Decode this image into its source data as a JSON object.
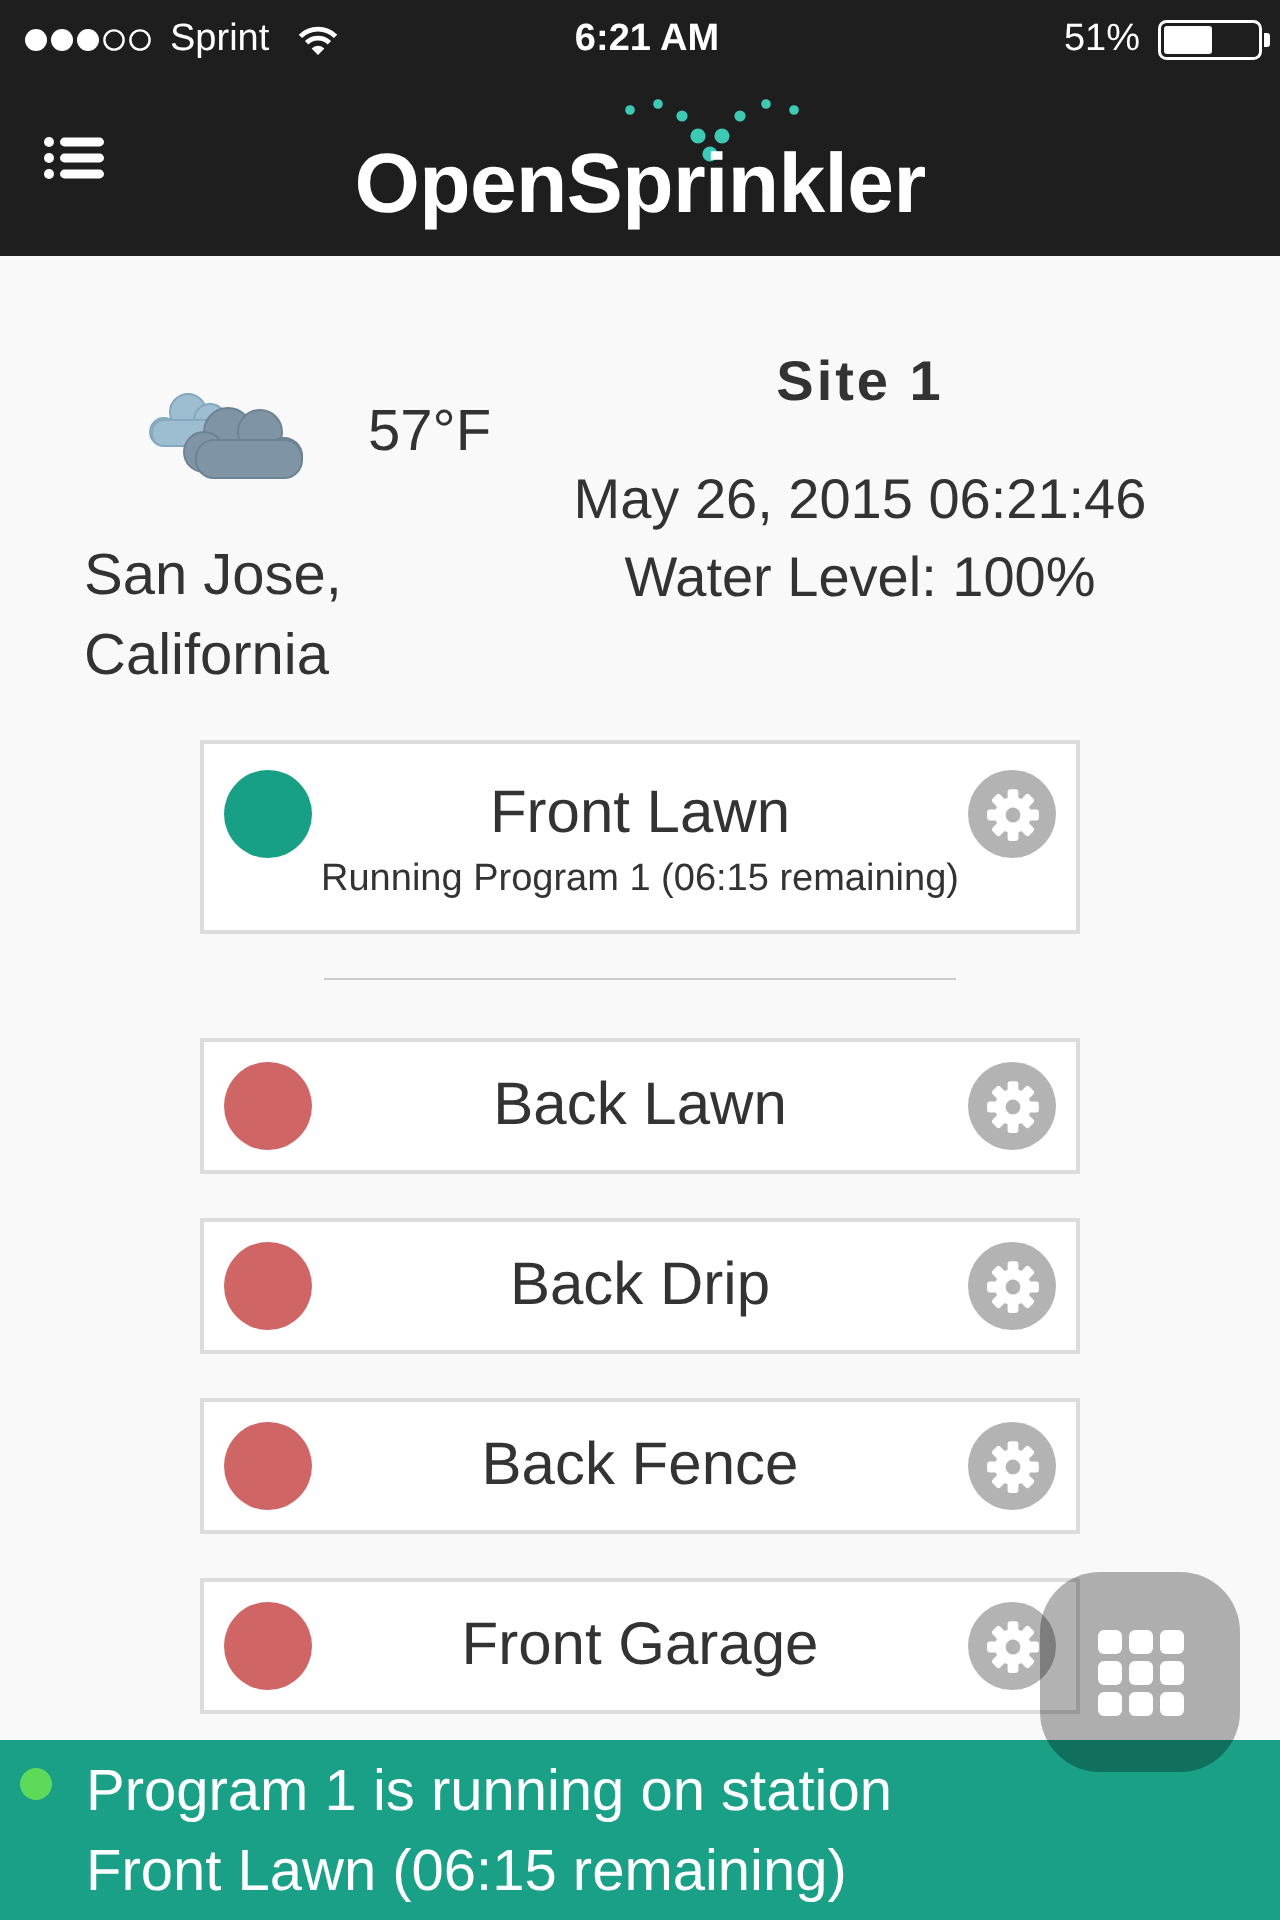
{
  "status_bar": {
    "carrier": "Sprint",
    "time": "6:21 AM",
    "battery": "51%"
  },
  "header": {
    "logo": "OpenSprinkler"
  },
  "weather": {
    "temperature": "57°F",
    "location": "San Jose, California"
  },
  "site": {
    "name": "Site 1",
    "datetime": "May 26, 2015 06:21:46",
    "water_level": "Water Level: 100%"
  },
  "station_groups": [
    {
      "stations": [
        {
          "name": "Front Lawn",
          "running": true,
          "status": "Running Program 1 (06:15 remaining)"
        }
      ]
    },
    {
      "stations": [
        {
          "name": "Back Lawn",
          "running": false
        },
        {
          "name": "Back Drip",
          "running": false
        },
        {
          "name": "Back Fence",
          "running": false
        },
        {
          "name": "Front Garage",
          "running": false
        }
      ]
    }
  ],
  "notification": {
    "text": "Program 1 is running on station Front Lawn (06:15 remaining)"
  }
}
